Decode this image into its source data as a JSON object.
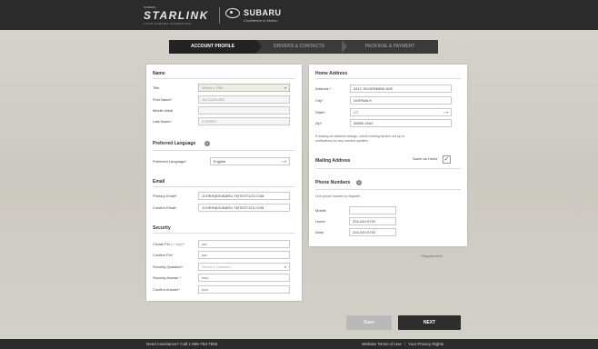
{
  "header": {
    "starlink_small": "SUBARU",
    "starlink_title": "STARLINK",
    "starlink_sub": "YOUR SUBARU CONNECTED",
    "brand": "SUBARU",
    "tagline": "Confidence in Motion"
  },
  "steps": [
    {
      "label": "ACCOUNT PROFILE",
      "active": true
    },
    {
      "label": "DRIVERS & CONTACTS",
      "active": false
    },
    {
      "label": "PACKAGE & PAYMENT",
      "active": false
    }
  ],
  "name": {
    "title": "Name",
    "title_label": "Title",
    "title_placeholder": "Select a Title...",
    "first_label": "First Name*",
    "first_value": "JACQUELINE",
    "middle_label": "Middle Initial",
    "middle_value": "",
    "last_label": "Last Name*",
    "last_value": "CHERRY"
  },
  "language": {
    "title": "Preferred Language",
    "label": "Preferred Language*",
    "value": "English"
  },
  "email": {
    "title": "Email",
    "primary_label": "Primary Email*",
    "primary_value": "JCHER@SUBARU.TMTEST123.COM",
    "confirm_label": "Confirm Email*",
    "confirm_value": "JCHER@SUBARU.TMTEST123.COM"
  },
  "security": {
    "title": "Security",
    "pin_label": "Create Pin",
    "pin_hint": "(4 digit)",
    "pin_req": "*",
    "pin_value": "••••",
    "confirm_pin_label": "Confirm Pin*",
    "confirm_pin_value": "••••",
    "question_label": "Security Question*",
    "question_placeholder": "Select a Question...",
    "answer_label": "Security Answer *",
    "answer_value": "•••••",
    "confirm_answer_label": "Confirm Answer*",
    "confirm_answer_value": "•••••"
  },
  "address": {
    "title": "Home Address",
    "address_label": "Address *",
    "address_value": "261C SILVERMINE AVE",
    "city_label": "City*",
    "city_value": "NORWALK",
    "state_label": "State*",
    "state_value": "CT",
    "zip_label": "Zip*",
    "zip_value": "06850-1842",
    "note": "If making an address change, check existing service set up or notifications for any needed updates."
  },
  "mailing": {
    "title": "Mailing Address",
    "same_label": "Same as Home",
    "checked": true
  },
  "phones": {
    "title": "Phone Numbers",
    "note": "One phone number is required.",
    "mobile_label": "Mobile",
    "mobile_value": "",
    "home_label": "Home",
    "home_value": "203-249-9700",
    "work_label": "Work",
    "work_value": "203-249-9700"
  },
  "required_note": "* Required field",
  "buttons": {
    "save": "Save",
    "next": "NEXT"
  },
  "footer": {
    "help": "Need Assistance? Call 1-855-753-7855",
    "terms": "Website Terms of Use",
    "privacy": "Your Privacy Rights"
  }
}
